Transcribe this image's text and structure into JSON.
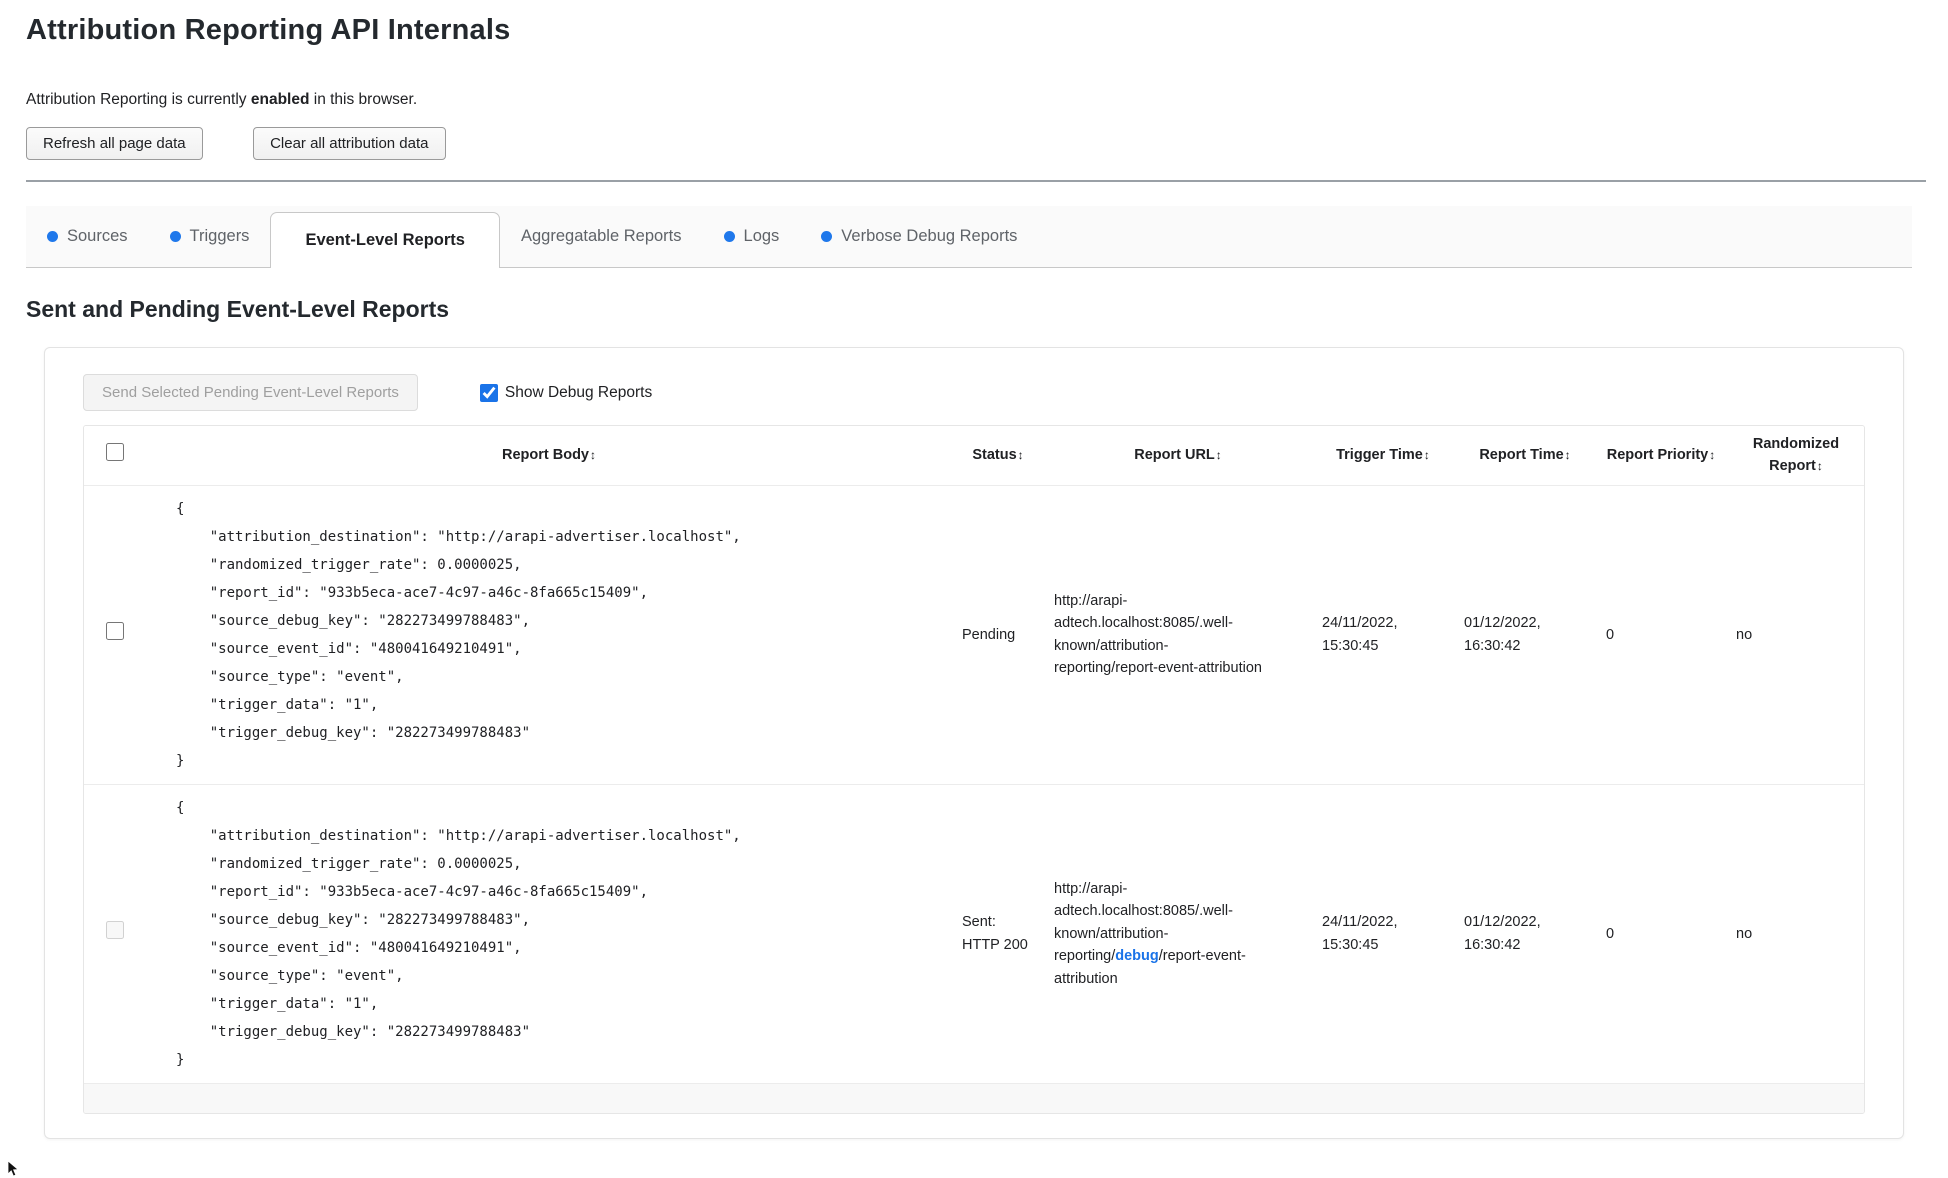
{
  "page": {
    "title": "Attribution Reporting API Internals",
    "status_prefix": "Attribution Reporting is currently ",
    "status_emphasis": "enabled",
    "status_suffix": " in this browser.",
    "refresh_button": "Refresh all page data",
    "clear_button": "Clear all attribution data"
  },
  "tabs": {
    "dot_color": "#1f78eb",
    "items": [
      {
        "label": "Sources",
        "has_dot": true,
        "active": false
      },
      {
        "label": "Triggers",
        "has_dot": true,
        "active": false
      },
      {
        "label": "Event-Level Reports",
        "has_dot": false,
        "active": true
      },
      {
        "label": "Aggregatable Reports",
        "has_dot": false,
        "active": false
      },
      {
        "label": "Logs",
        "has_dot": true,
        "active": false
      },
      {
        "label": "Verbose Debug Reports",
        "has_dot": true,
        "active": false
      }
    ]
  },
  "section": {
    "heading": "Sent and Pending Event-Level Reports",
    "send_button_label": "Send Selected Pending Event-Level Reports",
    "send_button_disabled": true,
    "show_debug_label": "Show Debug Reports",
    "show_debug_checked": true
  },
  "reports_table": {
    "sort_glyph": "↕",
    "columns": [
      "Report Body",
      "Status",
      "Report URL",
      "Trigger Time",
      "Report Time",
      "Report Priority",
      "Randomized Report"
    ],
    "rows": [
      {
        "selected": false,
        "checkbox_disabled": false,
        "report_body": "{\n    \"attribution_destination\": \"http://arapi-advertiser.localhost\",\n    \"randomized_trigger_rate\": 0.0000025,\n    \"report_id\": \"933b5eca-ace7-4c97-a46c-8fa665c15409\",\n    \"source_debug_key\": \"282273499788483\",\n    \"source_event_id\": \"480041649210491\",\n    \"source_type\": \"event\",\n    \"trigger_data\": \"1\",\n    \"trigger_debug_key\": \"282273499788483\"\n}",
        "status": "Pending",
        "report_url_prefix": "http://arapi-adtech.localhost:8085/.well-known/attribution-reporting/report-event-attribution",
        "report_url_link": "",
        "report_url_suffix": "",
        "trigger_time": "24/11/2022, 15:30:45",
        "report_time": "01/12/2022, 16:30:42",
        "report_priority": "0",
        "randomized_report": "no"
      },
      {
        "selected": false,
        "checkbox_disabled": true,
        "report_body": "{\n    \"attribution_destination\": \"http://arapi-advertiser.localhost\",\n    \"randomized_trigger_rate\": 0.0000025,\n    \"report_id\": \"933b5eca-ace7-4c97-a46c-8fa665c15409\",\n    \"source_debug_key\": \"282273499788483\",\n    \"source_event_id\": \"480041649210491\",\n    \"source_type\": \"event\",\n    \"trigger_data\": \"1\",\n    \"trigger_debug_key\": \"282273499788483\"\n}",
        "status": "Sent: HTTP 200",
        "report_url_prefix": "http://arapi-adtech.localhost:8085/.well-known/attribution-reporting/",
        "report_url_link": "debug",
        "report_url_suffix": "/report-event-attribution",
        "trigger_time": "24/11/2022, 15:30:45",
        "report_time": "01/12/2022, 16:30:42",
        "report_priority": "0",
        "randomized_report": "no"
      }
    ]
  }
}
